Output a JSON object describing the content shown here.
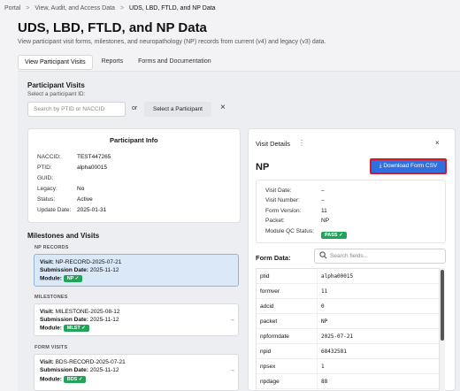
{
  "breadcrumb": [
    "Portal",
    "View, Audit, and Access Data",
    "UDS, LBD, FTLD, and NP Data"
  ],
  "page": {
    "title": "UDS, LBD, FTLD, and NP Data",
    "description": "View participant visit forms, milestones, and neuropathology (NP) records from current (v4) and legacy (v3) data."
  },
  "tabs": [
    "View Participant Visits",
    "Reports",
    "Forms and Documentation"
  ],
  "participant_visits": {
    "title": "Participant Visits",
    "subtitle": "Select a participant ID:",
    "search_placeholder": "Search by PTID or NACCID",
    "or_text": "or",
    "select_button": "Select a Participant",
    "clear_icon": "×"
  },
  "participant_info": {
    "title": "Participant Info",
    "fields": [
      {
        "label": "NACCID:",
        "value": "TEST447265"
      },
      {
        "label": "PTID:",
        "value": "alpha00015"
      },
      {
        "label": "GUID:",
        "value": ""
      },
      {
        "label": "Legacy:",
        "value": "No"
      },
      {
        "label": "Status:",
        "value": "Active"
      },
      {
        "label": "Update Date:",
        "value": "2025-01-31"
      }
    ]
  },
  "milestones": {
    "title": "Milestones and Visits",
    "sections": [
      {
        "label": "NP RECORDS",
        "visit": "NP-RECORD-2025-07-21",
        "submission": "2025-11-12",
        "module": "NP ✓"
      },
      {
        "label": "MILESTONES",
        "visit": "MILESTONE-2025-08-12",
        "submission": "2025-11-12",
        "module": "MLST ✓"
      },
      {
        "label": "FORM VISITS",
        "visit": "BDS-RECORD-2025-07-21",
        "submission": "2025-11-12",
        "module": "BDS ✓"
      }
    ],
    "visit_label": "Visit:",
    "submission_label": "Submission Date:",
    "module_label": "Module:",
    "arrow": "→"
  },
  "visit_details": {
    "title": "Visit Details",
    "dots": "⋮",
    "close": "×",
    "heading": "NP",
    "download_button": "Download Form CSV",
    "fields": [
      {
        "label": "Visit Date:",
        "value": "–"
      },
      {
        "label": "Visit Number:",
        "value": "–"
      },
      {
        "label": "Form Version:",
        "value": "11"
      },
      {
        "label": "Packet:",
        "value": "NP"
      }
    ],
    "qc_label": "Module QC Status:",
    "qc_badge": "PASS ✓",
    "form_data_label": "Form Data:",
    "fields_placeholder": "Search fields...",
    "form_data": [
      {
        "key": "ptid",
        "value": "alpha00015"
      },
      {
        "key": "formver",
        "value": "11"
      },
      {
        "key": "adcid",
        "value": "0"
      },
      {
        "key": "packet",
        "value": "NP"
      },
      {
        "key": "npformdate",
        "value": "2025-07-21"
      },
      {
        "key": "npid",
        "value": "68432581"
      },
      {
        "key": "npsex",
        "value": "1"
      },
      {
        "key": "npdage",
        "value": "88"
      }
    ]
  },
  "colors": {
    "accent": "#2f6fe0",
    "highlight": "#e0151b",
    "success": "#22a35a",
    "selected": "#dbe8f8"
  }
}
